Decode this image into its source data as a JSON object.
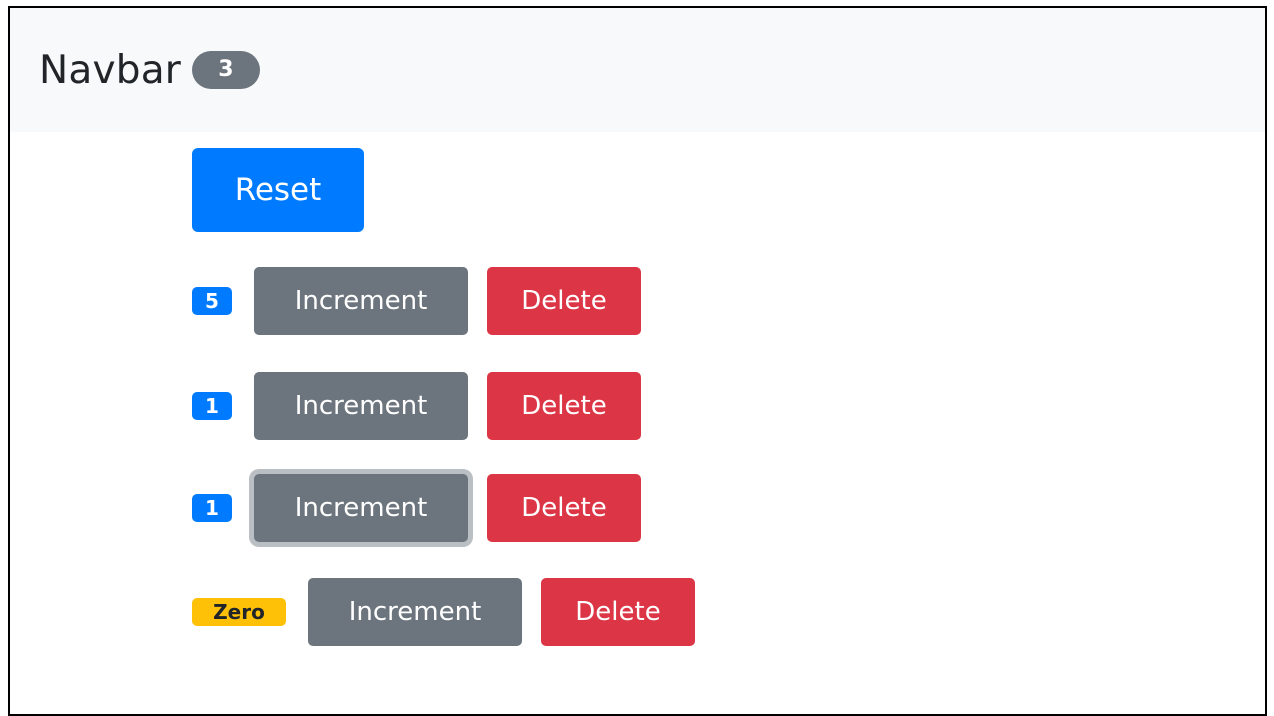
{
  "navbar": {
    "brand": "Navbar",
    "total_count": "3"
  },
  "reset_label": "Reset",
  "counters": [
    {
      "badge": "5",
      "badge_style": "primary",
      "increment_label": "Increment",
      "delete_label": "Delete",
      "focused": false
    },
    {
      "badge": "1",
      "badge_style": "primary",
      "increment_label": "Increment",
      "delete_label": "Delete",
      "focused": false
    },
    {
      "badge": "1",
      "badge_style": "primary",
      "increment_label": "Increment",
      "delete_label": "Delete",
      "focused": true
    },
    {
      "badge": "Zero",
      "badge_style": "warning",
      "increment_label": "Increment",
      "delete_label": "Delete",
      "focused": false
    }
  ],
  "colors": {
    "primary": "#007bff",
    "secondary": "#6c757d",
    "danger": "#dc3545",
    "warning": "#ffc107",
    "navbar_bg": "#f8f9fa"
  }
}
